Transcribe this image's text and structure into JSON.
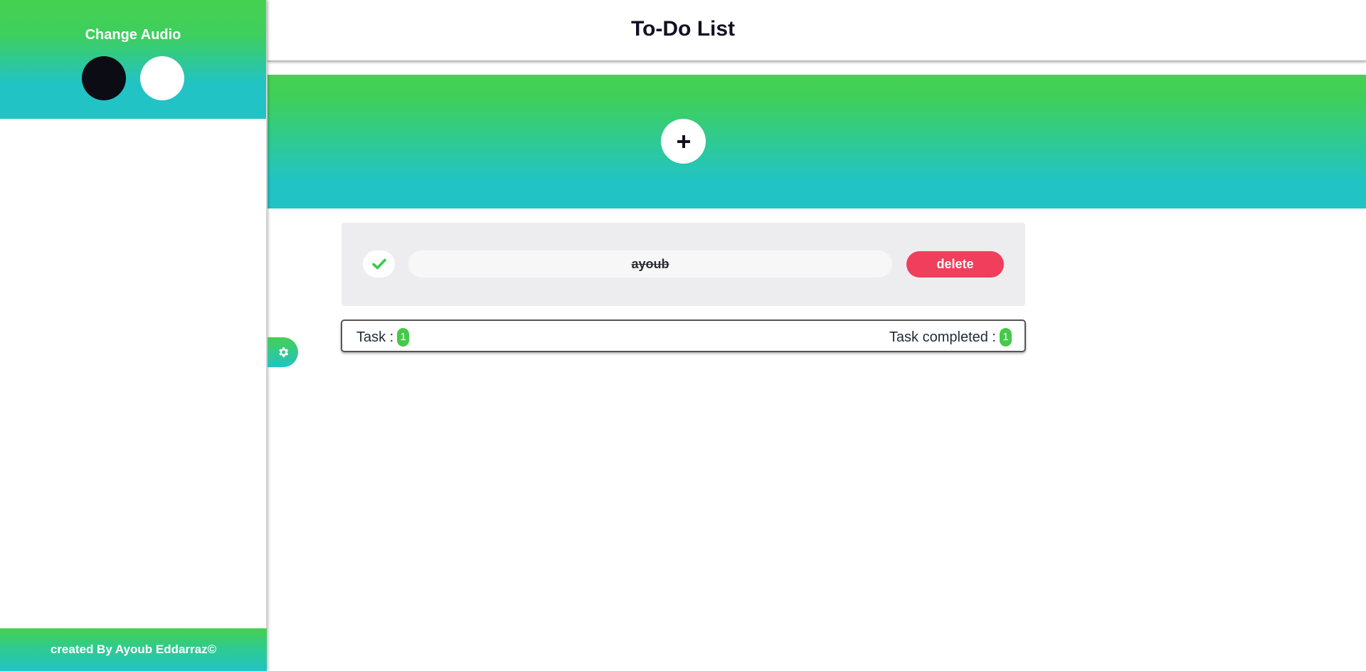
{
  "sidebar": {
    "title": "Change Audio",
    "audio_options": [
      {
        "name": "dark",
        "color": "#0c0c14"
      },
      {
        "name": "light",
        "color": "#ffffff"
      }
    ],
    "footer": "created By Ayoub Eddarraz©"
  },
  "header": {
    "title": "To-Do List"
  },
  "banner": {
    "add_label": "+",
    "gradient": [
      "#46d04f",
      "#22c3c4"
    ]
  },
  "tasks": [
    {
      "text": "ayoub",
      "completed": true,
      "delete_label": "delete"
    }
  ],
  "stats": {
    "task_label": "Task :",
    "task_count": "1",
    "completed_label": "Task completed :",
    "completed_count": "1"
  },
  "colors": {
    "accent_green": "#46d04f",
    "accent_teal": "#22c3c4",
    "delete_red": "#f03e5c",
    "badge_green": "#46c94a"
  },
  "icons": {
    "settings": "gear-icon",
    "check": "check-icon",
    "add": "plus-icon"
  }
}
